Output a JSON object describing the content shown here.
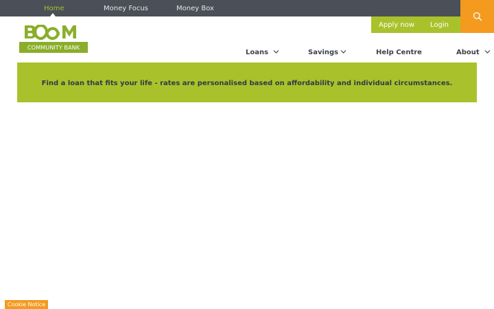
{
  "top_nav": {
    "items": [
      {
        "label": "Home",
        "active": true
      },
      {
        "label": "Money Focus",
        "active": false
      },
      {
        "label": "Money Box",
        "active": false
      }
    ]
  },
  "header_actions": {
    "apply_label": "Apply now",
    "login_label": "Login",
    "search_icon": "search-icon"
  },
  "logo": {
    "word": "BOOM",
    "subtitle": "COMMUNITY BANK"
  },
  "main_nav": {
    "items": [
      {
        "label": "Loans",
        "has_dropdown": true
      },
      {
        "label": "Savings",
        "has_dropdown": true
      },
      {
        "label": "Help Centre",
        "has_dropdown": false
      },
      {
        "label": "About",
        "has_dropdown": true
      }
    ]
  },
  "banner": {
    "text": "Find a loan that fits your life - rates are personalised based on affordability and individual circumstances."
  },
  "cookie_notice": {
    "label": "Cookie Notice"
  },
  "colors": {
    "topbar": "#4a4f58",
    "brand_green": "#a9c22c",
    "logo_green": "#8aae2a",
    "accent_orange": "#f39a1f",
    "nav_text": "#3d424a"
  }
}
